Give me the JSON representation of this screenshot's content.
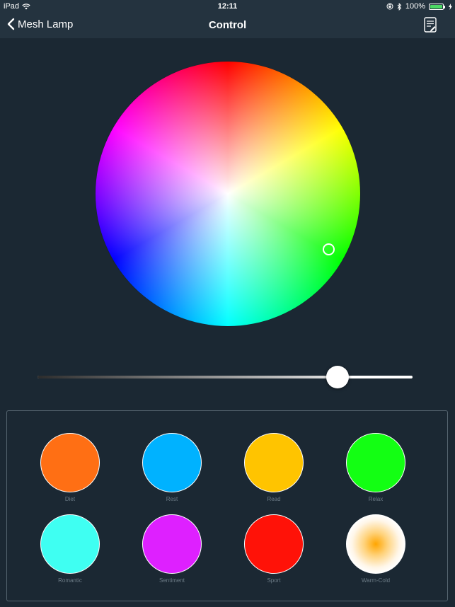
{
  "status_bar": {
    "device": "iPad",
    "time": "12:11",
    "battery_pct": "100%",
    "icons": [
      "wifi-icon",
      "orientation-lock-icon",
      "bluetooth-icon",
      "battery-icon",
      "charging-icon"
    ]
  },
  "nav": {
    "back_label": "Mesh Lamp",
    "title": "Control",
    "edit_icon": "notepad-edit-icon"
  },
  "color_wheel": {
    "marker_color": "#ffffff"
  },
  "brightness": {
    "value": 0.8
  },
  "presets": [
    {
      "label": "Diet",
      "color": "#ff6f14"
    },
    {
      "label": "Rest",
      "color": "#00b2ff"
    },
    {
      "label": "Read",
      "color": "#ffc400"
    },
    {
      "label": "Relax",
      "color": "#13ff13"
    },
    {
      "label": "Romantic",
      "color": "#3ffff2"
    },
    {
      "label": "Sentiment",
      "color": "#de20ff"
    },
    {
      "label": "Sport",
      "color": "#ff1208"
    },
    {
      "label": "Warm-Cold",
      "color": "#ffa500"
    }
  ],
  "colors": {
    "background": "#1b2833",
    "bar": "#24333f",
    "panel_border": "#566570",
    "label": "#6b7a85"
  }
}
